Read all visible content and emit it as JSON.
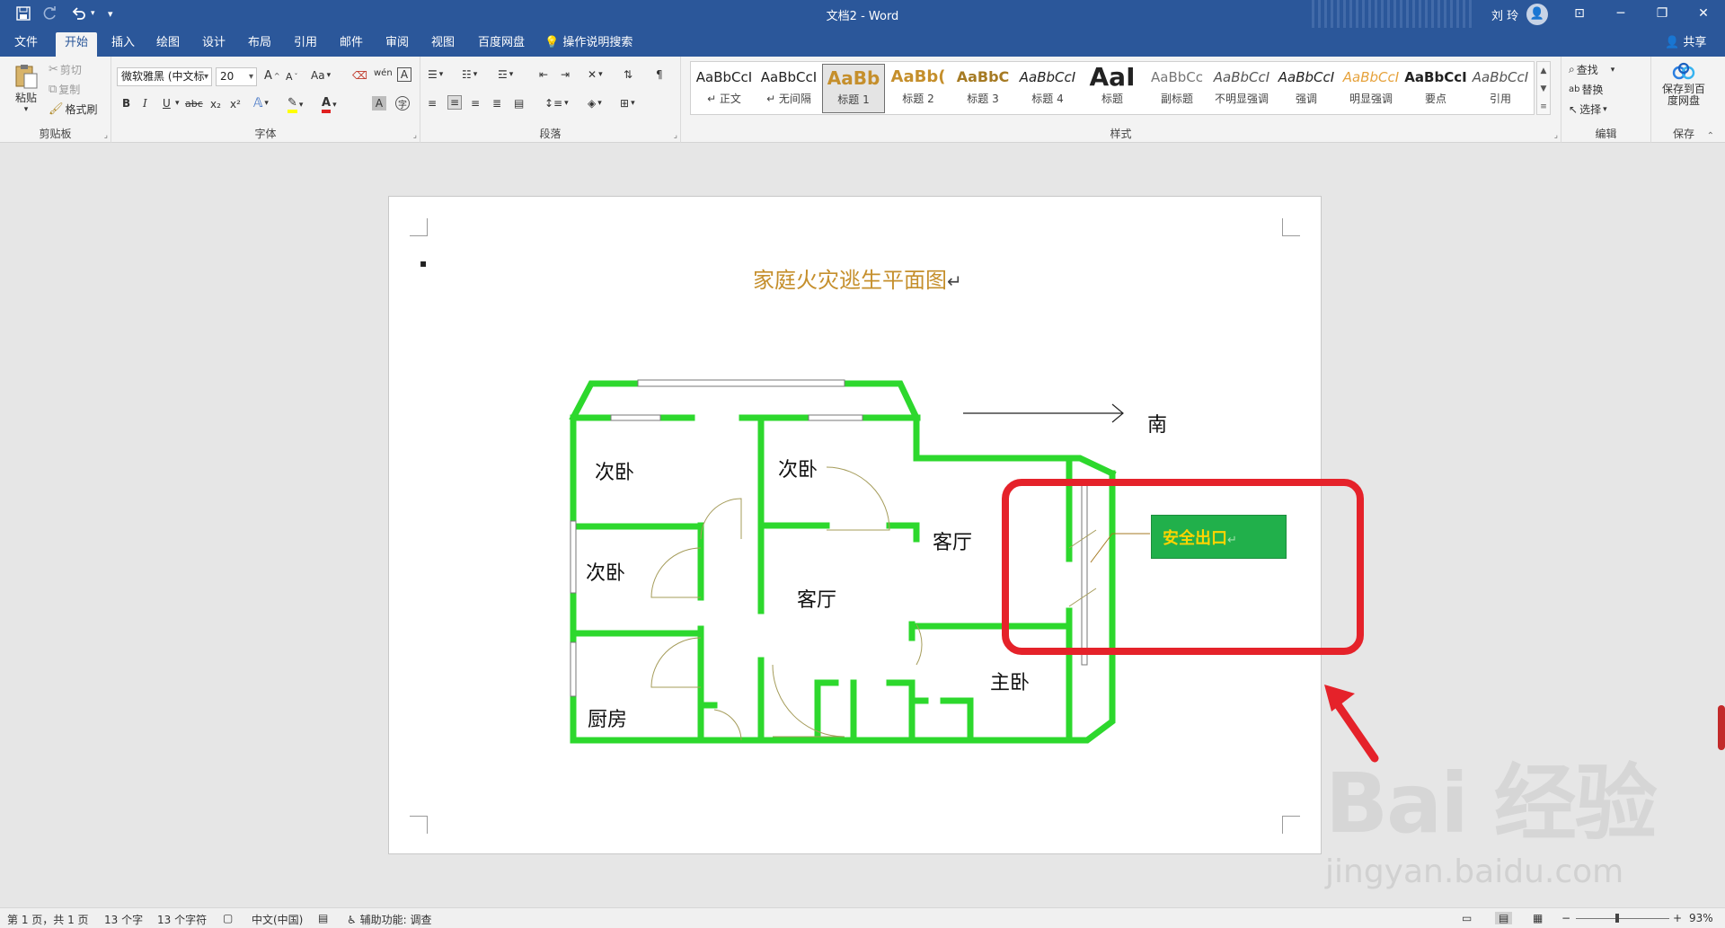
{
  "titlebar": {
    "doc_title": "文档2 - Word",
    "user_name": "刘 玲",
    "avatar_glyph": "👤",
    "save_icon": "save-icon",
    "redo_icon": "redo-icon",
    "undo_icon": "undo-icon",
    "customize_icon": "customize-quick-access-icon",
    "ribbon_display_glyph": "⊡",
    "minimize_glyph": "─",
    "restore_glyph": "❐",
    "close_glyph": "✕"
  },
  "tabs": [
    {
      "label": "文件"
    },
    {
      "label": "开始"
    },
    {
      "label": "插入"
    },
    {
      "label": "绘图"
    },
    {
      "label": "设计"
    },
    {
      "label": "布局"
    },
    {
      "label": "引用"
    },
    {
      "label": "邮件"
    },
    {
      "label": "审阅"
    },
    {
      "label": "视图"
    },
    {
      "label": "百度网盘"
    }
  ],
  "tell_me": "操作说明搜索",
  "share": "共享",
  "clipboard": {
    "paste": "粘贴",
    "cut": "剪切",
    "copy": "复制",
    "format_painter": "格式刷",
    "label": "剪贴板"
  },
  "font": {
    "name": "微软雅黑 (中文标",
    "size": "20",
    "label": "字体",
    "grow": "A",
    "shrink": "A",
    "case": "Aa",
    "bold": "B",
    "italic": "I",
    "underline": "U",
    "strike": "abc",
    "subscript": "x₂",
    "superscript": "x²"
  },
  "paragraph": {
    "label": "段落"
  },
  "styles": {
    "label": "样式",
    "items": [
      {
        "sample": "AaBbCcI",
        "name": "↵ 正文"
      },
      {
        "sample": "AaBbCcI",
        "name": "↵ 无间隔"
      },
      {
        "sample": "AaBb",
        "name": "标题 1"
      },
      {
        "sample": "AaBb(",
        "name": "标题 2"
      },
      {
        "sample": "AaBbC",
        "name": "标题 3"
      },
      {
        "sample": "AaBbCcI",
        "name": "标题 4"
      },
      {
        "sample": "AaI",
        "name": "标题"
      },
      {
        "sample": "AaBbCc",
        "name": "副标题"
      },
      {
        "sample": "AaBbCcI",
        "name": "不明显强调"
      },
      {
        "sample": "AaBbCcI",
        "name": "强调"
      },
      {
        "sample": "AaBbCcI",
        "name": "明显强调"
      },
      {
        "sample": "AaBbCcI",
        "name": "要点"
      },
      {
        "sample": "AaBbCcI",
        "name": "引用"
      }
    ]
  },
  "editing": {
    "find": "查找",
    "replace": "替换",
    "select": "选择",
    "label": "编辑"
  },
  "save_group": {
    "save_to_baidu": "保存到百度网盘",
    "label": "保存"
  },
  "document": {
    "title": "家庭火灾逃生平面图",
    "cursor_mark": "↵",
    "bullet": "▪",
    "compass_label": "南",
    "exit_label": "安全出口",
    "exit_mark": "↵",
    "rooms": [
      {
        "id": "bedroom-top-left",
        "label": "次卧"
      },
      {
        "id": "bedroom-top-middle",
        "label": "次卧"
      },
      {
        "id": "bedroom-left",
        "label": "次卧"
      },
      {
        "id": "living-room-center",
        "label": "客厅"
      },
      {
        "id": "living-room-right",
        "label": "客厅"
      },
      {
        "id": "kitchen",
        "label": "厨房"
      },
      {
        "id": "master-bedroom",
        "label": "主卧"
      }
    ]
  },
  "watermark": {
    "logo": "Bai 经验",
    "url": "jingyan.baidu.com"
  },
  "status": {
    "page": "第 1 页，共 1 页",
    "words": "13 个字",
    "chars": "13 个字符",
    "language": "中文(中国)",
    "accessibility": "辅助功能: 调查",
    "zoom": "93%",
    "minus": "−",
    "plus": "+"
  },
  "colors": {
    "ribbon_blue": "#2b579a",
    "wall_green": "#2dd82d",
    "title_gold": "#c58f2c",
    "highlight_red": "#e5222a",
    "exit_bg": "#21b04b",
    "exit_text": "#ffd400"
  }
}
